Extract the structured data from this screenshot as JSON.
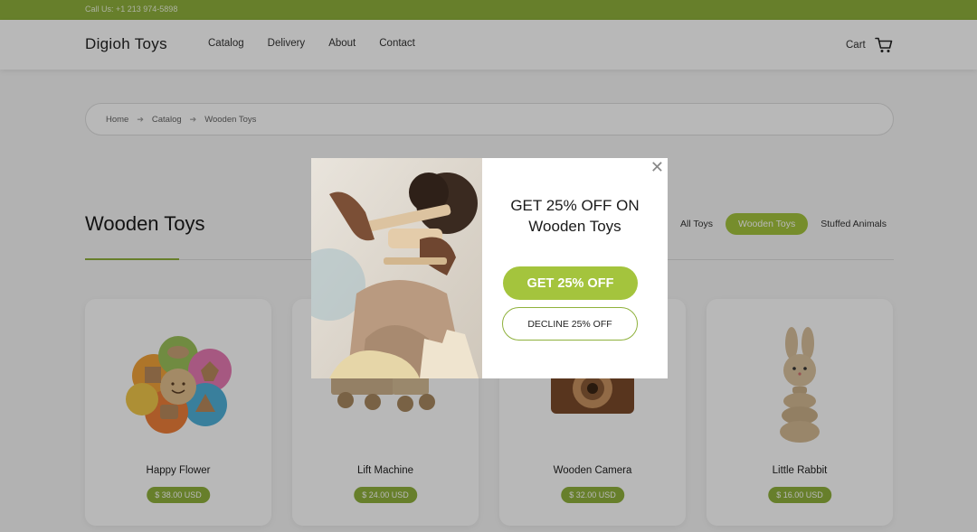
{
  "topbar": {
    "phone": "Call Us: +1 213 974-5898"
  },
  "header": {
    "logo": "Digioh Toys",
    "nav": [
      "Catalog",
      "Delivery",
      "About",
      "Contact"
    ],
    "cart_label": "Cart"
  },
  "breadcrumb": [
    "Home",
    "Catalog",
    "Wooden Toys"
  ],
  "page": {
    "title": "Wooden Toys"
  },
  "filters": [
    {
      "label": "All Toys",
      "active": false
    },
    {
      "label": "Wooden Toys",
      "active": true
    },
    {
      "label": "Stuffed Animals",
      "active": false
    }
  ],
  "products": [
    {
      "name": "Happy Flower",
      "price": "$ 38.00 USD"
    },
    {
      "name": "Lift Machine",
      "price": "$ 24.00 USD"
    },
    {
      "name": "Wooden Camera",
      "price": "$ 32.00 USD"
    },
    {
      "name": "Little Rabbit",
      "price": "$ 16.00 USD"
    }
  ],
  "modal": {
    "headline_line1": "GET 25% OFF ON",
    "headline_line2": "Wooden Toys",
    "accept_label": "GET 25% OFF",
    "decline_label": "DECLINE 25% OFF",
    "close_icon": "close-icon"
  },
  "colors": {
    "brand_green": "#8fb13c",
    "button_green": "#a4c43d"
  }
}
